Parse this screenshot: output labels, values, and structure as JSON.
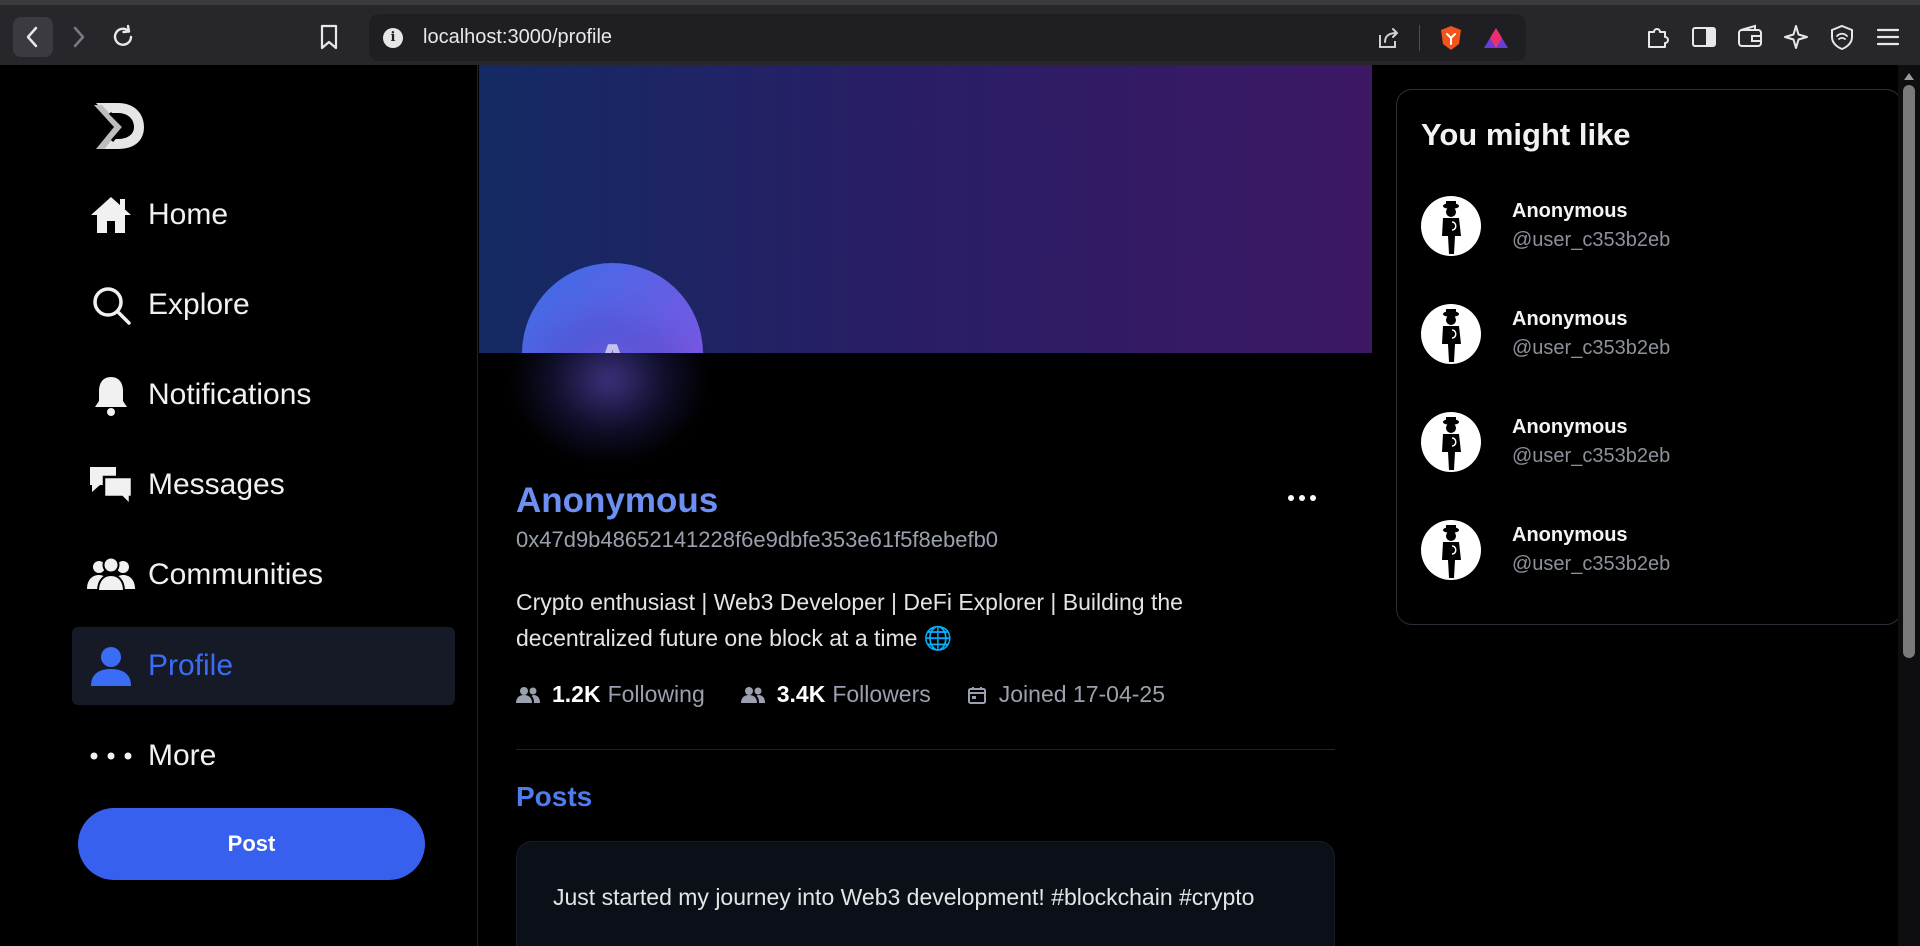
{
  "browser": {
    "url": "localhost:3000/profile"
  },
  "sidebar": {
    "items": [
      {
        "label": "Home",
        "icon": "home-icon"
      },
      {
        "label": "Explore",
        "icon": "search-icon"
      },
      {
        "label": "Notifications",
        "icon": "bell-icon"
      },
      {
        "label": "Messages",
        "icon": "chat-bubbles-icon"
      },
      {
        "label": "Communities",
        "icon": "people-icon"
      },
      {
        "label": "Profile",
        "icon": "person-icon",
        "active": true
      },
      {
        "label": "More",
        "icon": "dots-icon"
      }
    ],
    "post_button": "Post"
  },
  "profile": {
    "avatar_initial": "A",
    "name": "Anonymous",
    "address": "0x47d9b48652141228f6e9dbfe353e61f5f8ebefb0",
    "bio": "Crypto enthusiast | Web3 Developer | DeFi Explorer | Building the decentralized future one block at a time 🌐",
    "following_count": "1.2K",
    "following_label": "Following",
    "followers_count": "3.4K",
    "followers_label": "Followers",
    "joined": "Joined 17-04-25",
    "posts_heading": "Posts",
    "posts": [
      {
        "text": "Just started my journey into Web3 development! #blockchain #crypto"
      }
    ]
  },
  "suggestions": {
    "heading": "You might like",
    "users": [
      {
        "name": "Anonymous",
        "handle": "@user_c353b2eb"
      },
      {
        "name": "Anonymous",
        "handle": "@user_c353b2eb"
      },
      {
        "name": "Anonymous",
        "handle": "@user_c353b2eb"
      },
      {
        "name": "Anonymous",
        "handle": "@user_c353b2eb"
      }
    ]
  },
  "colors": {
    "accent": "#3860ee",
    "name": "#6c8ff2",
    "banner_start": "#142a63",
    "banner_end": "#3d1864"
  }
}
